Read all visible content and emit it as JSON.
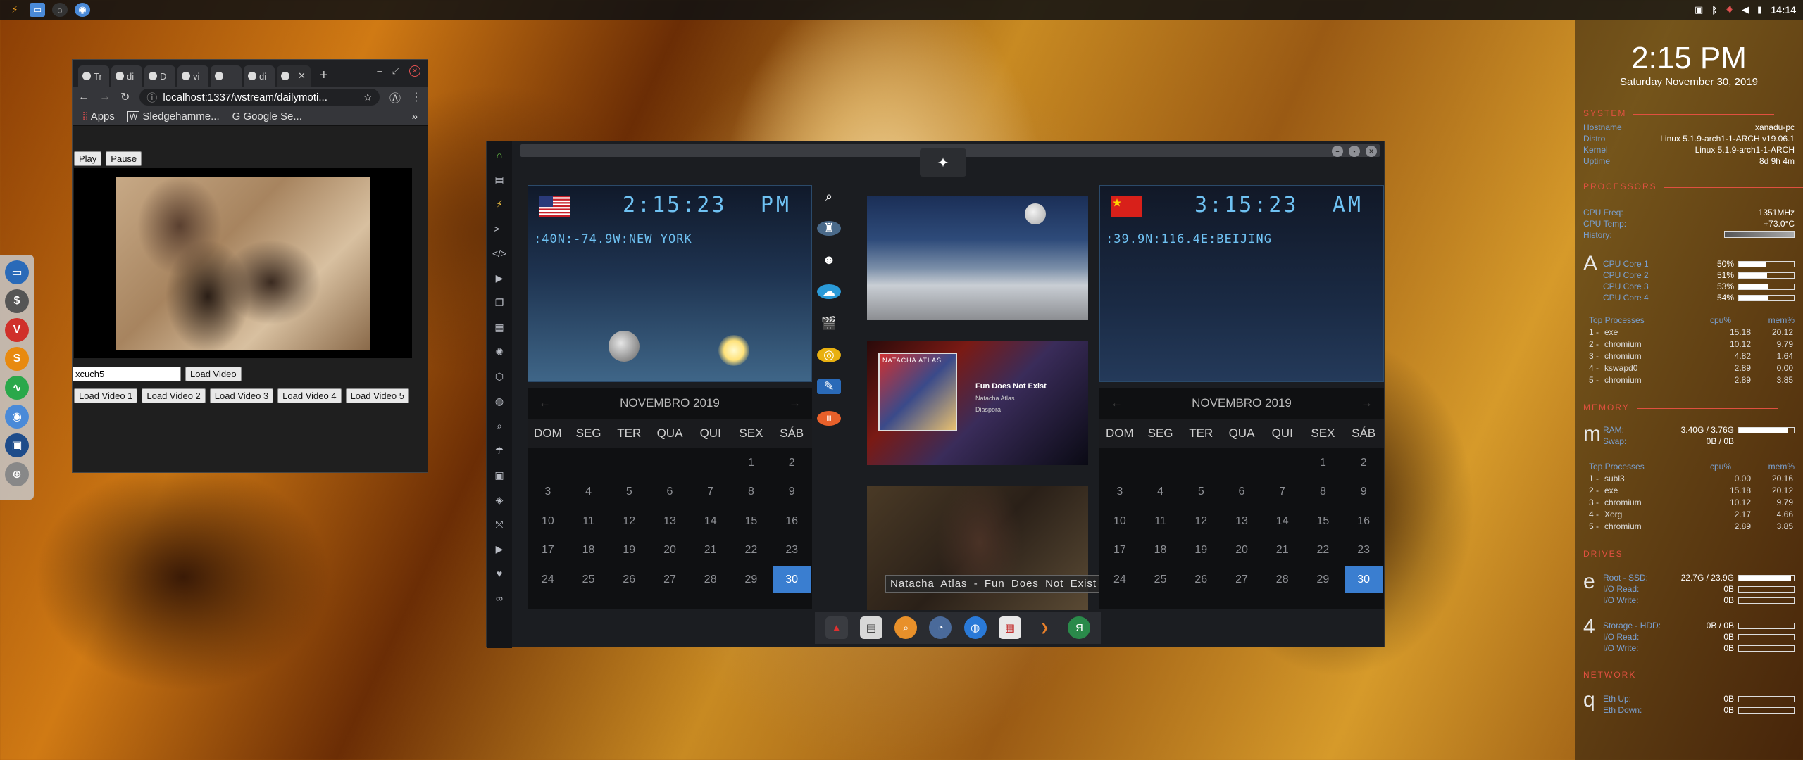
{
  "topbar": {
    "clock": "14:14"
  },
  "chrome": {
    "tabs": [
      "Tr",
      "di",
      "D",
      "vi",
      "",
      "di",
      ""
    ],
    "url": "localhost:1337/wstream/dailymoti...",
    "bookmarks": {
      "apps": "Apps",
      "b1": "Sledgehamme...",
      "b2": "Google Se...",
      "more": "»"
    },
    "play_label": "Play",
    "pause_label": "Pause",
    "video_input": "xcuch5",
    "load_label": "Load Video",
    "load_buttons": [
      "Load Video 1",
      "Load Video 2",
      "Load Video 3",
      "Load Video 4",
      "Load Video 5"
    ]
  },
  "edex": {
    "left": {
      "time": "2:15:23",
      "ampm": "PM",
      "coords": ":40N:-74.9W:NEW YORK"
    },
    "right": {
      "time": "3:15:23",
      "ampm": "AM",
      "coords": ":39.9N:116.4E:BEIJING"
    },
    "calendar": {
      "month": "NOVEMBRO 2019",
      "weekdays": [
        "DOM",
        "SEG",
        "TER",
        "QUA",
        "QUI",
        "SEX",
        "SÁB"
      ],
      "today": 30,
      "first_weekday": 5,
      "days": 30
    },
    "media": {
      "album_line1": "Fun Does Not Exist",
      "album_line2": "Natacha Atlas",
      "album_line3": "Diaspora",
      "album_cover": "NATACHA ATLAS",
      "tooltip": "Natacha Atlas - Fun Does Not Exist"
    }
  },
  "conky": {
    "time": "2:15 PM",
    "date": "Saturday November 30, 2019",
    "system": {
      "header": "SYSTEM",
      "hostname_k": "Hostname",
      "hostname": "xanadu-pc",
      "distro_k": "Distro",
      "distro": "Linux 5.1.9-arch1-1-ARCH v19.06.1",
      "kernel_k": "Kernel",
      "kernel": "Linux 5.1.9-arch1-1-ARCH",
      "uptime_k": "Uptime",
      "uptime": "8d 9h 4m"
    },
    "processors": {
      "header": "PROCESSORS",
      "freq_k": "CPU Freq:",
      "freq": "1351MHz",
      "temp_k": "CPU Temp:",
      "temp": "+73.0°C",
      "hist_k": "History:",
      "cores": [
        {
          "k": "CPU Core 1",
          "v": "50%",
          "f": 0.5
        },
        {
          "k": "CPU Core 2",
          "v": "51%",
          "f": 0.51
        },
        {
          "k": "CPU Core 3",
          "v": "53%",
          "f": 0.53
        },
        {
          "k": "CPU Core 4",
          "v": "54%",
          "f": 0.54
        }
      ],
      "top_k": "Top Processes",
      "cpu_k": "cpu%",
      "mem_k": "mem%",
      "top": [
        {
          "n": "1",
          "name": "exe",
          "c": "15.18",
          "m": "20.12"
        },
        {
          "n": "2",
          "name": "chromium",
          "c": "10.12",
          "m": "9.79"
        },
        {
          "n": "3",
          "name": "chromium",
          "c": "4.82",
          "m": "1.64"
        },
        {
          "n": "4",
          "name": "kswapd0",
          "c": "2.89",
          "m": "0.00"
        },
        {
          "n": "5",
          "name": "chromium",
          "c": "2.89",
          "m": "3.85"
        }
      ]
    },
    "memory": {
      "header": "MEMORY",
      "ram_k": "RAM:",
      "ram": "3.40G / 3.76G",
      "ram_f": 0.9,
      "swap_k": "Swap:",
      "swap": "0B / 0B",
      "top": [
        {
          "n": "1",
          "name": "subl3",
          "c": "0.00",
          "m": "20.16"
        },
        {
          "n": "2",
          "name": "exe",
          "c": "15.18",
          "m": "20.12"
        },
        {
          "n": "3",
          "name": "chromium",
          "c": "10.12",
          "m": "9.79"
        },
        {
          "n": "4",
          "name": "Xorg",
          "c": "2.17",
          "m": "4.66"
        },
        {
          "n": "5",
          "name": "chromium",
          "c": "2.89",
          "m": "3.85"
        }
      ]
    },
    "drives": {
      "header": "DRIVES",
      "root_k": "Root - SSD:",
      "root": "22.7G / 23.9G",
      "root_f": 0.95,
      "ior_k": "I/O Read:",
      "ior": "0B",
      "iow_k": "I/O Write:",
      "iow": "0B",
      "st_k": "Storage - HDD:",
      "st": "0B / 0B",
      "ior2": "0B",
      "iow2": "0B"
    },
    "network": {
      "header": "NETWORK",
      "up_k": "Eth Up:",
      "up": "0B",
      "down_k": "Eth Down:",
      "down": "0B"
    },
    "glyphs": {
      "proc": "A",
      "mem": "m",
      "drive": "e",
      "storage": "4",
      "net": "q"
    }
  }
}
